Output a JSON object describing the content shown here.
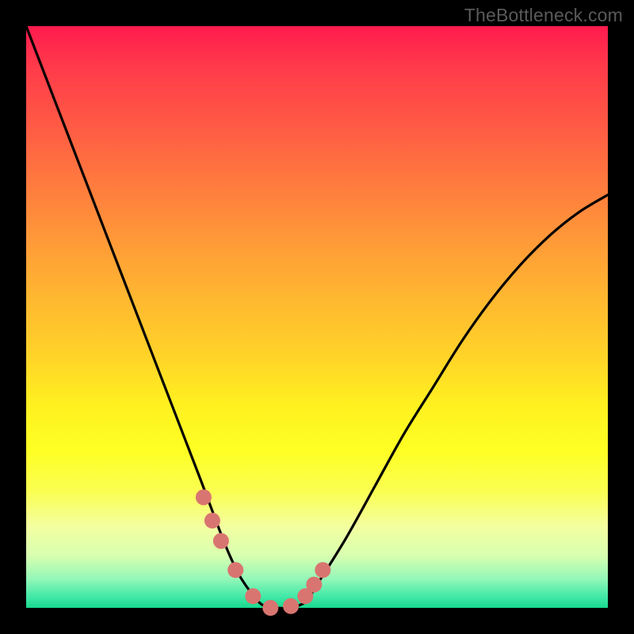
{
  "watermark": "TheBottleneck.com",
  "colors": {
    "frame": "#000000",
    "curve": "#000000",
    "marker": "#d97570",
    "gradient_top": "#ff1a4f",
    "gradient_bottom": "#18d88e"
  },
  "chart_data": {
    "type": "line",
    "title": "",
    "xlabel": "",
    "ylabel": "",
    "xlim": [
      0,
      100
    ],
    "ylim": [
      0,
      100
    ],
    "series": [
      {
        "name": "curve",
        "x": [
          0,
          5,
          10,
          15,
          20,
          25,
          30,
          33,
          35,
          37,
          40,
          42,
          43,
          45,
          48,
          50,
          55,
          60,
          65,
          70,
          75,
          80,
          85,
          90,
          95,
          100
        ],
        "y": [
          100,
          87,
          74,
          61,
          48,
          35,
          22,
          14,
          9,
          5,
          1,
          0,
          0,
          0,
          1,
          4,
          12,
          21,
          30,
          38,
          46,
          53,
          59,
          64,
          68,
          71
        ]
      }
    ],
    "markers": {
      "name": "highlighted-points",
      "x": [
        30.5,
        32.0,
        33.5,
        36.0,
        39.0,
        42.0,
        45.5,
        48.0,
        49.5,
        51.0
      ],
      "y": [
        19.0,
        15.0,
        11.5,
        6.5,
        2.0,
        0.0,
        0.3,
        2.0,
        4.0,
        6.5
      ]
    }
  }
}
